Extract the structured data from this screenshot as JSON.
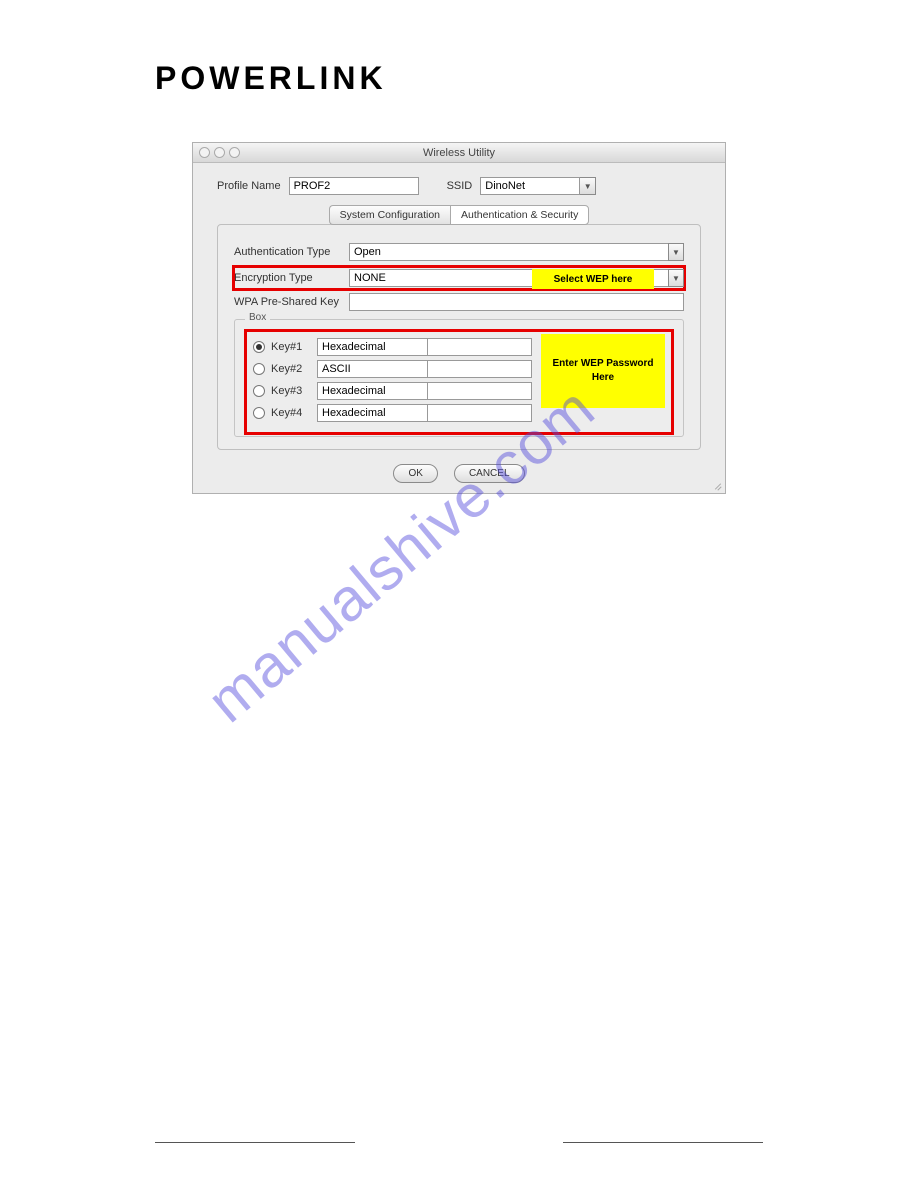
{
  "brand": "POWERLINK",
  "window": {
    "title": "Wireless Utility",
    "profile_name_label": "Profile Name",
    "profile_name_value": "PROF2",
    "ssid_label": "SSID",
    "ssid_value": "DinoNet",
    "tabs": {
      "system": "System Configuration",
      "auth": "Authentication & Security"
    },
    "auth_type_label": "Authentication Type",
    "auth_type_value": "Open",
    "enc_type_label": "Encryption Type",
    "enc_type_value": "NONE",
    "enc_note": "Select WEP here",
    "wpa_label": "WPA Pre-Shared Key",
    "wpa_value": "",
    "box_legend": "Box",
    "keys": [
      {
        "label": "Key#1",
        "format": "Hexadecimal",
        "checked": true,
        "value": ""
      },
      {
        "label": "Key#2",
        "format": "ASCII",
        "checked": false,
        "value": ""
      },
      {
        "label": "Key#3",
        "format": "Hexadecimal",
        "checked": false,
        "value": ""
      },
      {
        "label": "Key#4",
        "format": "Hexadecimal",
        "checked": false,
        "value": ""
      }
    ],
    "wep_note": "Enter WEP Password Here",
    "ok": "OK",
    "cancel": "CANCEL"
  },
  "watermark": "manualshive.com"
}
